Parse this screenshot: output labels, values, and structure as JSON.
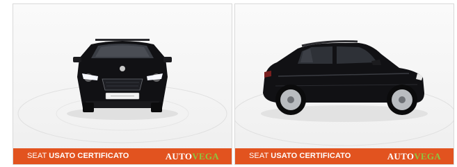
{
  "gallery": {
    "images": [
      {
        "view": "front",
        "plate": "",
        "banner": {
          "brand": "SEAT",
          "label": "USATO CERTIFICATO"
        },
        "logo": {
          "part1": "AUTO",
          "part2": "VEGA"
        }
      },
      {
        "view": "side",
        "banner": {
          "brand": "SEAT",
          "label": "USATO CERTIFICATO"
        },
        "logo": {
          "part1": "AUTO",
          "part2": "VEGA"
        }
      }
    ]
  },
  "colors": {
    "banner_bg": "#e2531f",
    "logo_accent": "#8dc63f",
    "car_body": "#111114",
    "backdrop": "#f4f4f4"
  }
}
